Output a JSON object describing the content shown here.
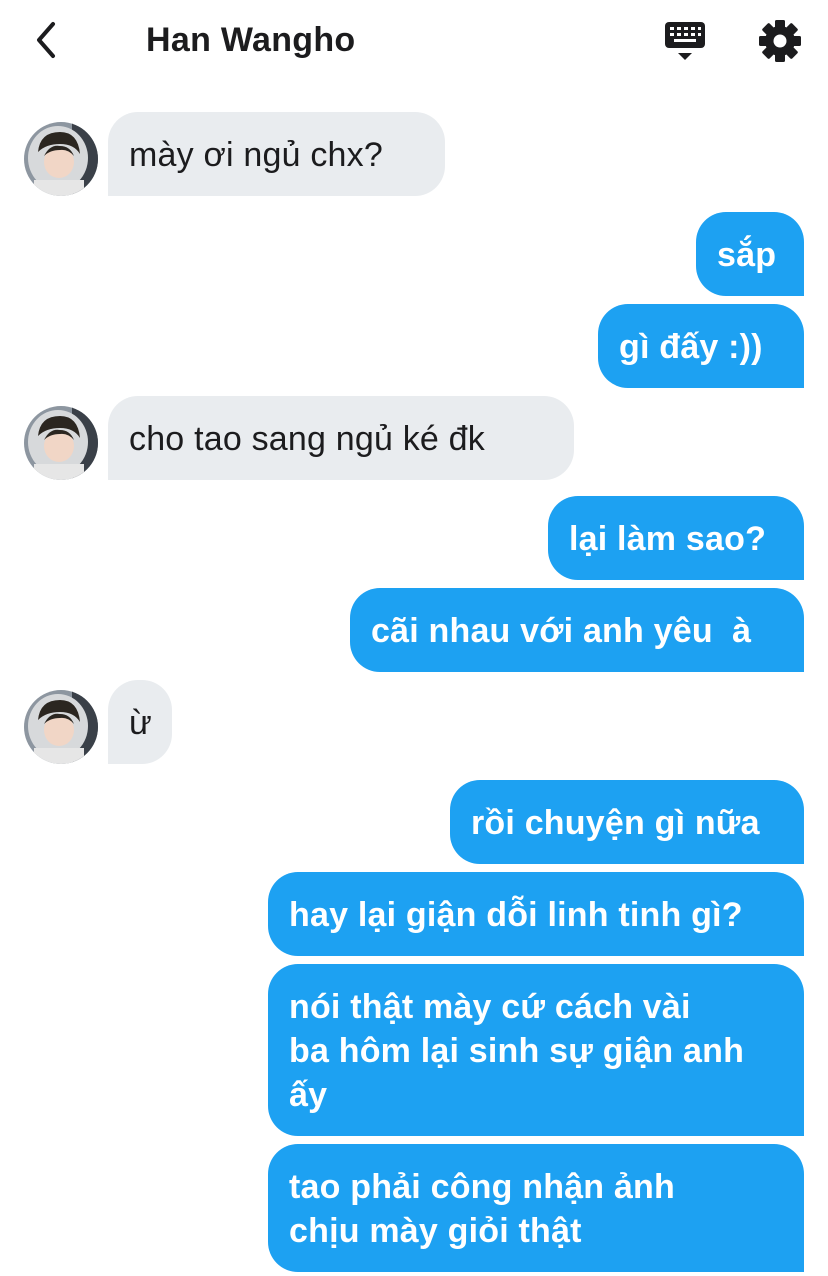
{
  "header": {
    "title": "Han Wangho",
    "back_icon": "chevron-left-icon",
    "keyboard_icon": "keyboard-icon",
    "settings_icon": "gear-icon"
  },
  "colors": {
    "outgoing_bubble": "#1da1f2",
    "incoming_bubble": "#e9ecef",
    "text_dark": "#1c1c1e"
  },
  "messages": [
    {
      "from": "contact",
      "text": "mày ơi ngủ chx?"
    },
    {
      "from": "me",
      "text": "sắp"
    },
    {
      "from": "me",
      "text": "gì đấy :))"
    },
    {
      "from": "contact",
      "text": "cho tao sang ngủ ké đk"
    },
    {
      "from": "me",
      "text": "lại làm sao?"
    },
    {
      "from": "me",
      "text": "cãi nhau với anh yêu  à"
    },
    {
      "from": "contact",
      "text": "ừ"
    },
    {
      "from": "me",
      "text": "rồi chuyện gì nữa"
    },
    {
      "from": "me",
      "text": "hay lại giận dỗi linh tinh gì?"
    },
    {
      "from": "me",
      "text": "nói thật mày cứ cách vài\nba hôm lại sinh sự giận anh\nấy"
    },
    {
      "from": "me",
      "text": "tao phải công nhận ảnh\nchịu mày giỏi thật"
    }
  ]
}
